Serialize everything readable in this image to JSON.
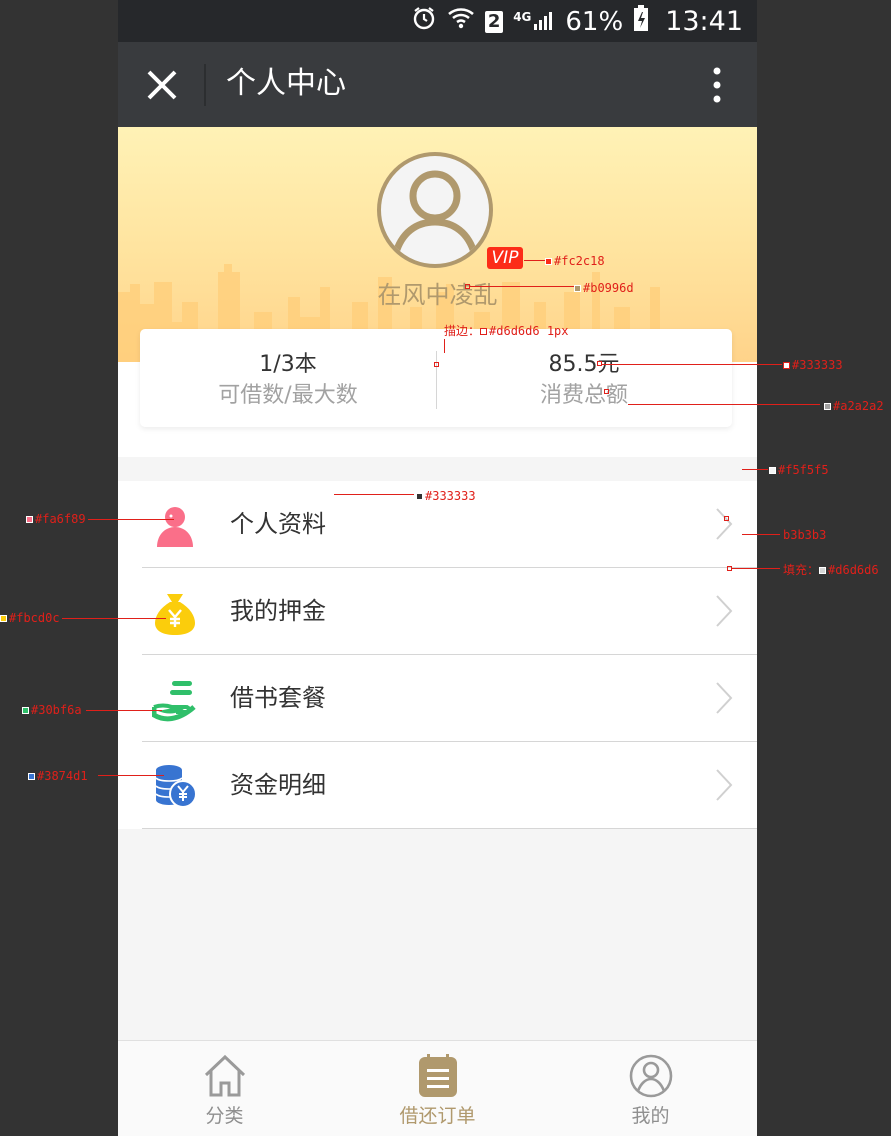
{
  "status_bar": {
    "battery": "61%",
    "time": "13:41",
    "network": "4G",
    "sim": "2"
  },
  "title_bar": {
    "title": "个人中心"
  },
  "profile": {
    "vip_label": "VIP",
    "username": "在风中凌乱"
  },
  "stats": {
    "borrow_value": "1/3本",
    "borrow_label": "可借数/最大数",
    "spend_value": "85.5元",
    "spend_label": "消费总额"
  },
  "menu": {
    "items": [
      {
        "label": "个人资料",
        "icon": "person-icon",
        "color": "#fa6f89"
      },
      {
        "label": "我的押金",
        "icon": "money-bag-icon",
        "color": "#fbcd0c"
      },
      {
        "label": "借书套餐",
        "icon": "hand-package-icon",
        "color": "#30bf6a"
      },
      {
        "label": "资金明细",
        "icon": "coins-icon",
        "color": "#3874d1"
      }
    ]
  },
  "tabs": [
    {
      "label": "分类",
      "icon": "home-icon"
    },
    {
      "label": "借还订单",
      "icon": "order-list-icon"
    },
    {
      "label": "我的",
      "icon": "user-circle-icon"
    }
  ],
  "annotations": {
    "vip": "#fc2c18",
    "username": "#b0996d",
    "stroke": "描边：",
    "stroke_value": "#d6d6d6 1px",
    "stat_value": "#333333",
    "stat_label": "#a2a2a2",
    "bg": "#f5f5f5",
    "menu_text": "#333333",
    "chevron": "b3b3b3",
    "fill": "填充：",
    "fill_value": "#d6d6d6",
    "person": "#fa6f89",
    "bag": "#fbcd0c",
    "package": "#30bf6a",
    "coins": "#3874d1"
  },
  "colors": {
    "vip": "#fc2c18",
    "gold": "#b0996d",
    "text": "#333333",
    "subtext": "#a2a2a2",
    "divider": "#d6d6d6",
    "bg": "#f5f5f5",
    "chevron": "#b3b3b3"
  }
}
